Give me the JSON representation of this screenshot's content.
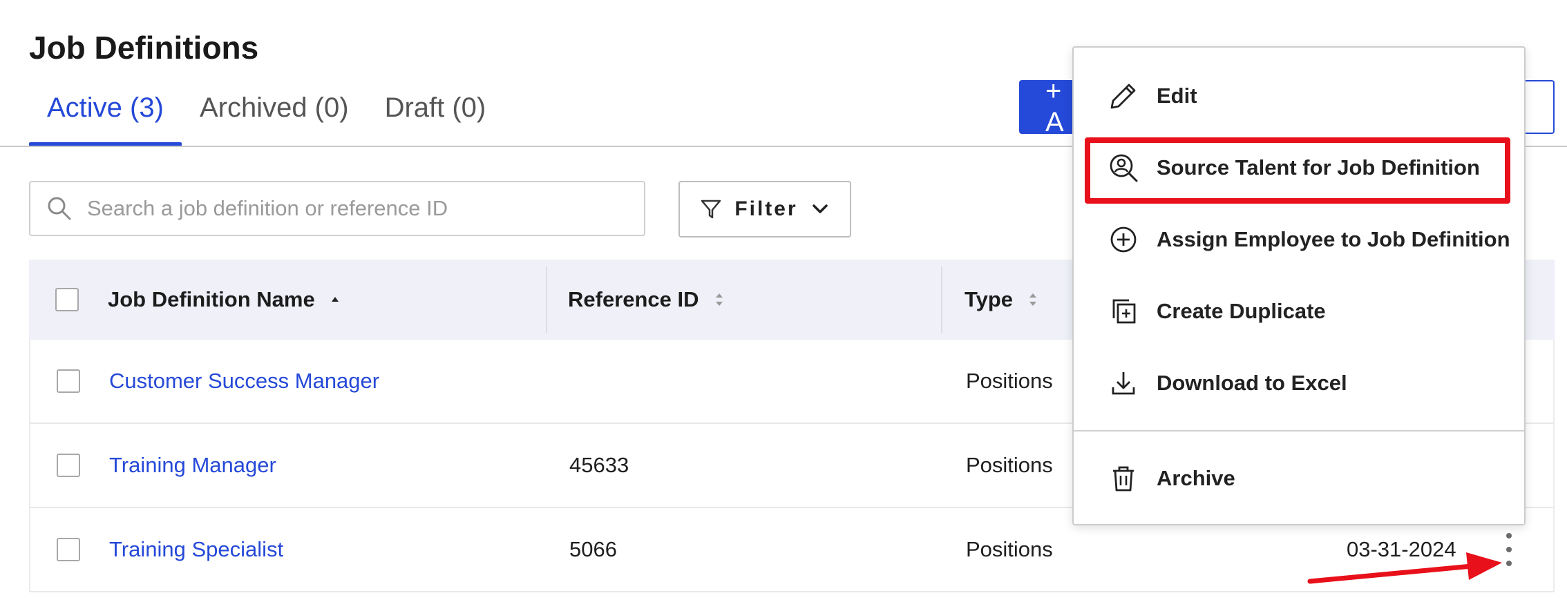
{
  "page": {
    "title": "Job Definitions"
  },
  "tabs": [
    {
      "label": "Active (3)"
    },
    {
      "label": "Archived (0)"
    },
    {
      "label": "Draft (0)"
    }
  ],
  "toolbar": {
    "search_placeholder": "Search a job definition or reference ID",
    "filter_label": "Filter",
    "add_label": "+ A"
  },
  "table": {
    "headers": {
      "name": "Job Definition Name",
      "ref": "Reference ID",
      "type": "Type"
    },
    "rows": [
      {
        "name": "Customer Success Manager",
        "ref": "",
        "type": "Positions",
        "date": ""
      },
      {
        "name": "Training Manager",
        "ref": "45633",
        "type": "Positions",
        "date": ""
      },
      {
        "name": "Training Specialist",
        "ref": "5066",
        "type": "Positions",
        "date": "03-31-2024"
      }
    ]
  },
  "menu": {
    "items": [
      {
        "label": "Edit",
        "icon": "pencil-icon"
      },
      {
        "label": "Source Talent for Job Definition",
        "icon": "person-search-icon"
      },
      {
        "label": "Assign Employee to Job Definition",
        "icon": "plus-circle-icon"
      },
      {
        "label": "Create Duplicate",
        "icon": "duplicate-icon"
      },
      {
        "label": "Download to Excel",
        "icon": "download-icon"
      },
      {
        "label": "Archive",
        "icon": "trash-icon"
      }
    ]
  },
  "colors": {
    "accent": "#2549d8",
    "annotation": "#e8101a",
    "header_bg": "#eff0f8"
  }
}
